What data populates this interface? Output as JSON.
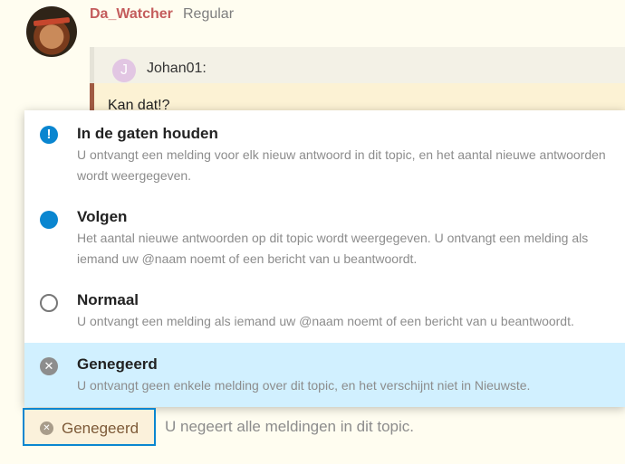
{
  "post": {
    "username": "Da_Watcher",
    "user_title": "Regular"
  },
  "quote": {
    "avatar_letter": "J",
    "author": "Johan01:",
    "text": "Kan dat!?"
  },
  "notification_menu": {
    "options": [
      {
        "title": "In de gaten houden",
        "description": "U ontvangt een melding voor elk nieuw antwoord in dit topic, en het aantal nieuwe antwoorden wordt weergegeven.",
        "icon": "exclamation-circle-icon",
        "icon_glyph": "!"
      },
      {
        "title": "Volgen",
        "description": "Het aantal nieuwe antwoorden op dit topic wordt weergegeven. U ontvangt een melding als iemand uw @naam noemt of een bericht van u beantwoordt.",
        "icon": "filled-circle-icon"
      },
      {
        "title": "Normaal",
        "description": "U ontvangt een melding als iemand uw @naam noemt of een bericht van u beantwoordt.",
        "icon": "empty-circle-icon"
      },
      {
        "title": "Genegeerd",
        "description": "U ontvangt geen enkele melding over dit topic, en het verschijnt niet in Nieuwste.",
        "icon": "times-circle-icon",
        "icon_glyph": "✕",
        "selected": true
      }
    ]
  },
  "footer": {
    "button_label": "Genegeerd",
    "button_icon_glyph": "✕",
    "status_text": "U negeert alle meldingen in dit topic."
  },
  "colors": {
    "accent": "#0a86d0",
    "selected_bg": "#d1f0ff",
    "username": "#c45c5c"
  }
}
